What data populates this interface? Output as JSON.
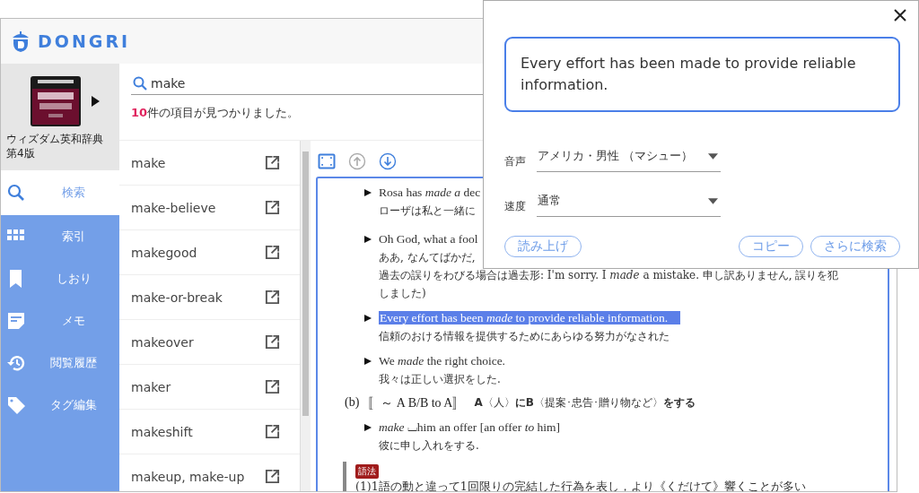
{
  "app": {
    "logo": "DONGRI"
  },
  "book": {
    "title": "ウィズダム英和辞典",
    "edition": "第4版"
  },
  "nav": [
    {
      "kind": "search",
      "label": "検索",
      "selected": true
    },
    {
      "kind": "index",
      "label": "索引",
      "selected": false
    },
    {
      "kind": "bookmark",
      "label": "しおり",
      "selected": false
    },
    {
      "kind": "memo",
      "label": "メモ",
      "selected": false
    },
    {
      "kind": "history",
      "label": "閲覧履歴",
      "selected": false
    },
    {
      "kind": "tag",
      "label": "タグ編集",
      "selected": false
    }
  ],
  "search": {
    "value": "make"
  },
  "result_count": {
    "count": "10",
    "text": "件の項目が見つかりました。"
  },
  "results": [
    {
      "word": "make"
    },
    {
      "word": "make-believe"
    },
    {
      "word": "makegood"
    },
    {
      "word": "make-or-break"
    },
    {
      "word": "makeover"
    },
    {
      "word": "maker"
    },
    {
      "word": "makeshift"
    },
    {
      "word": "makeup, make-up"
    }
  ],
  "toolbar": [
    {
      "kind": "fit",
      "disabled": false
    },
    {
      "kind": "up",
      "disabled": true
    },
    {
      "kind": "down",
      "disabled": false
    }
  ],
  "entries": [
    {
      "kind": "example",
      "en": "Rosa has *made a* dec",
      "ja": [
        "ローザは私と一緒に"
      ],
      "highlighted": false
    },
    {
      "kind": "example",
      "en": "Oh God, what a fool",
      "ja": [
        "ああ, なんてばかだ,",
        "過去の誤りをわびる場合は過去形: I'm sorry. I *made* a mistake. 申し訳ありません, 誤りを犯",
        "しました)"
      ],
      "highlighted": false
    },
    {
      "kind": "example",
      "en": "Every effort has been *made* to provide reliable information.",
      "ja": [
        "信頼のおける情報を提供するためにあらゆる努力がなされた"
      ],
      "highlighted": true
    },
    {
      "kind": "example",
      "en": "We *made* the right choice.",
      "ja": [
        "我々は正しい選択をした."
      ],
      "highlighted": false
    },
    {
      "kind": "sense",
      "label": "(b)",
      "pattern": "〚～ A B/B to A〛",
      "meaning": "**A**〈人〉**にB**〈提案･忠告･贈り物など〉**をする**"
    },
    {
      "kind": "example",
      "en": "*make* ⌴him an offer [an offer *to* him]",
      "ja": [
        "彼に申し入れをする."
      ],
      "highlighted": false
    },
    {
      "kind": "usage",
      "badge": "語法",
      "text": "(1)1語の動と違って1回限りの完結した行為を表し，より《くだけて》響くことが多い"
    }
  ],
  "dialog": {
    "text": "Every effort has been made to provide reliable information.",
    "fields": [
      {
        "label": "音声",
        "value": "アメリカ・男性 （マシュー）"
      },
      {
        "label": "速度",
        "value": "通常"
      }
    ],
    "buttons_left": [
      {
        "label": "読み上げ"
      }
    ],
    "buttons_right": [
      {
        "label": "コピー"
      },
      {
        "label": "さらに検索"
      }
    ]
  }
}
